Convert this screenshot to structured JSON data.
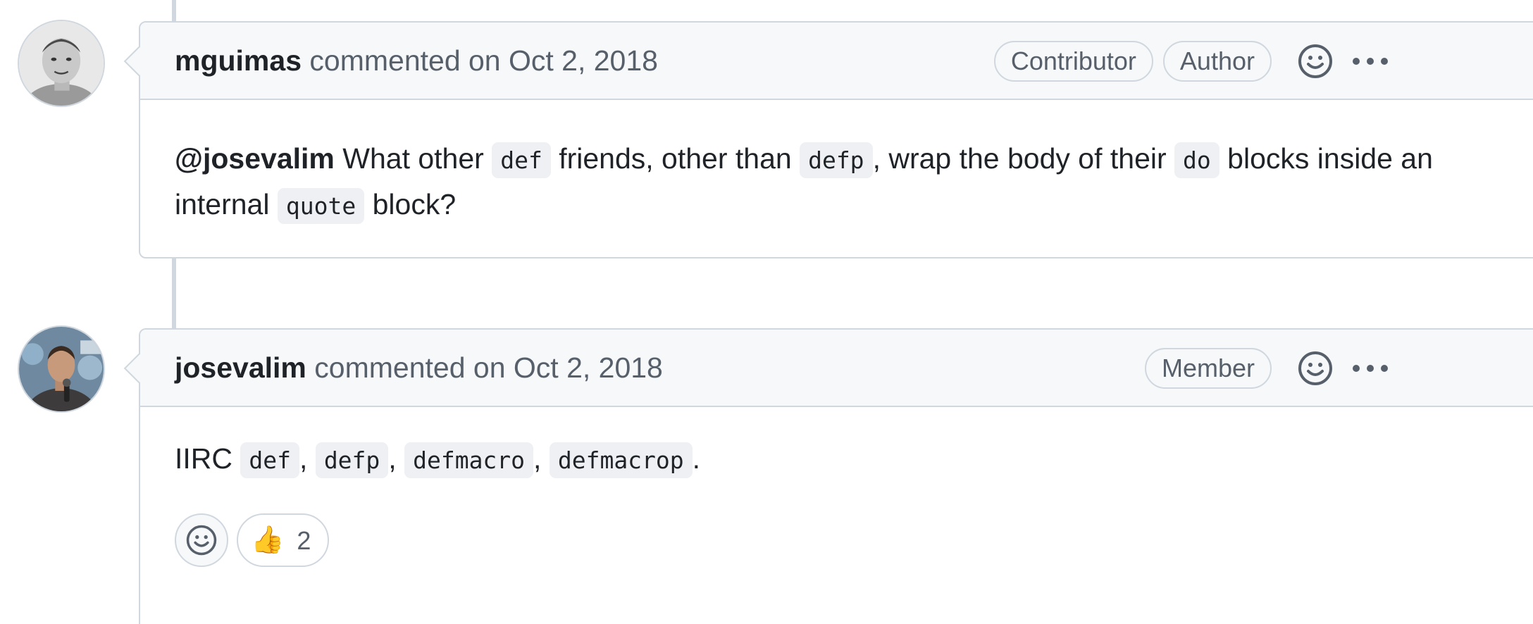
{
  "comments": [
    {
      "author": "mguimas",
      "meta": "commented on Oct 2, 2018",
      "badges": [
        "Contributor",
        "Author"
      ],
      "body": {
        "mention": "@josevalim",
        "t1": " What other ",
        "c1": "def",
        "t2": " friends, other than ",
        "c2": "defp",
        "t3": ", wrap the body of their ",
        "c3": "do",
        "t4": " blocks inside an internal ",
        "c4": "quote",
        "t5": " block?"
      }
    },
    {
      "author": "josevalim",
      "meta": "commented on Oct 2, 2018",
      "badges": [
        "Member"
      ],
      "body": {
        "t1": "IIRC ",
        "c1": "def",
        "t2": ", ",
        "c2": "defp",
        "t3": ", ",
        "c3": "defmacro",
        "t4": ", ",
        "c4": "defmacrop",
        "t5": "."
      },
      "reactions": [
        {
          "emoji": "👍",
          "count": "2"
        }
      ]
    }
  ],
  "colors": {
    "border": "#d0d7de",
    "header_bg": "#f6f8fa",
    "code_bg": "#eef0f3",
    "muted_text": "#57606a"
  },
  "icons": [
    "smiley-icon",
    "kebab-horizontal-icon"
  ]
}
